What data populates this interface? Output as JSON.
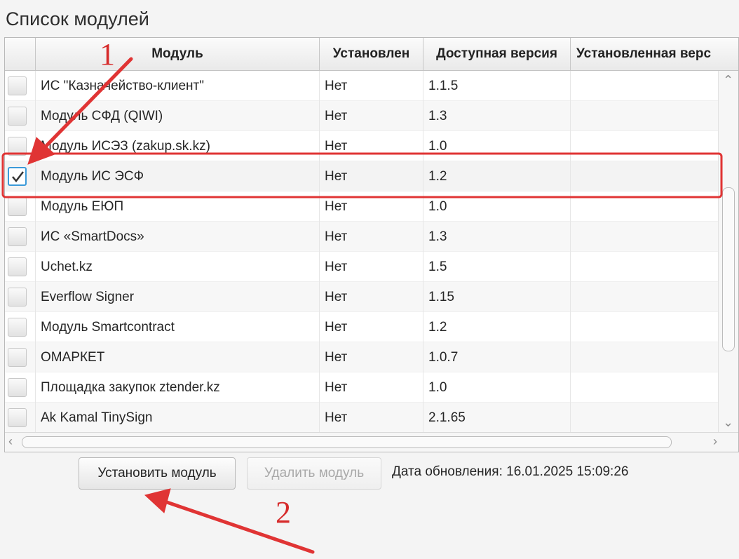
{
  "title": "Список модулей",
  "table": {
    "columns": [
      "",
      "Модуль",
      "Установлен",
      "Доступная версия",
      "Установленная верс"
    ],
    "rows": [
      {
        "checked": false,
        "name": "ИС \"Казначейство-клиент\"",
        "installed": "Нет",
        "available": "1.1.5",
        "installed_version": ""
      },
      {
        "checked": false,
        "name": "Модуль СФД (QIWI)",
        "installed": "Нет",
        "available": "1.3",
        "installed_version": ""
      },
      {
        "checked": false,
        "name": "Модуль ИСЭЗ (zakup.sk.kz)",
        "installed": "Нет",
        "available": "1.0",
        "installed_version": ""
      },
      {
        "checked": true,
        "name": "Модуль ИС ЭСФ",
        "installed": "Нет",
        "available": "1.2",
        "installed_version": ""
      },
      {
        "checked": false,
        "name": "Модуль ЕЮП",
        "installed": "Нет",
        "available": "1.0",
        "installed_version": ""
      },
      {
        "checked": false,
        "name": "ИС «SmartDocs»",
        "installed": "Нет",
        "available": "1.3",
        "installed_version": ""
      },
      {
        "checked": false,
        "name": "Uchet.kz",
        "installed": "Нет",
        "available": "1.5",
        "installed_version": ""
      },
      {
        "checked": false,
        "name": "Everflow Signer",
        "installed": "Нет",
        "available": "1.15",
        "installed_version": ""
      },
      {
        "checked": false,
        "name": "Модуль Smartcontract",
        "installed": "Нет",
        "available": "1.2",
        "installed_version": ""
      },
      {
        "checked": false,
        "name": "ОМАРКЕТ",
        "installed": "Нет",
        "available": "1.0.7",
        "installed_version": ""
      },
      {
        "checked": false,
        "name": "Площадка закупок ztender.kz",
        "installed": "Нет",
        "available": "1.0",
        "installed_version": ""
      },
      {
        "checked": false,
        "name": "Ak Kamal TinySign",
        "installed": "Нет",
        "available": "2.1.65",
        "installed_version": ""
      }
    ]
  },
  "buttons": {
    "install": "Установить модуль",
    "remove": "Удалить модуль"
  },
  "update_info": "Дата обновления: 16.01.2025 15:09:26",
  "annotations": {
    "step1": "1",
    "step2": "2",
    "color": "#d62b2b"
  },
  "colors": {
    "accent": "#3b9ad9",
    "annotation": "#e03434"
  }
}
